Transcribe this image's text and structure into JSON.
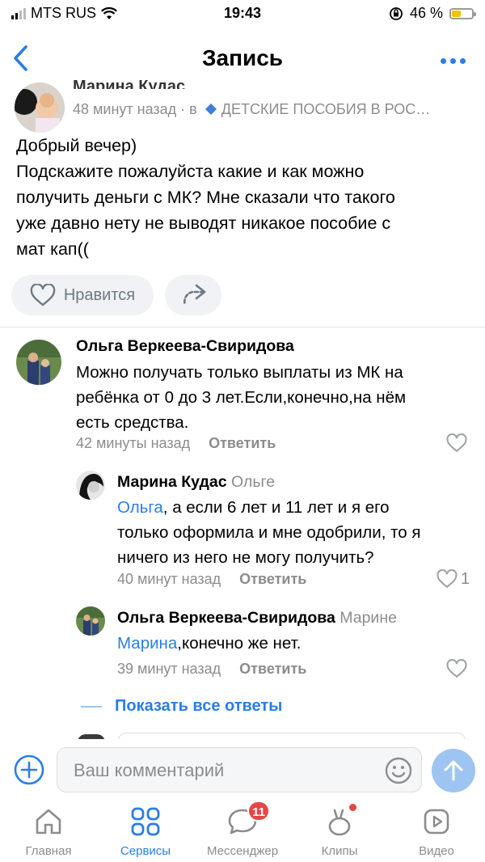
{
  "status_bar": {
    "carrier": "MTS RUS",
    "time": "19:43",
    "battery_text": "46 %",
    "battery_level": 0.46
  },
  "header": {
    "title": "Запись"
  },
  "post": {
    "author_partial": "Марина Кудас",
    "time": "48 минут назад",
    "in_sep": "· в",
    "group": "ДЕТСКИЕ ПОСОБИЯ В РОС…",
    "text_lines": [
      "Добрый вечер)",
      "Подскажите пожалуйста какие и как можно",
      "получить деньги с МК? Мне сказали что такого",
      "уже давно нету не выводят никакое пособие с",
      "мат кап(("
    ],
    "like_label": "Нравится"
  },
  "comments": [
    {
      "author": "Ольга Веркеева-Свиридова",
      "lines": [
        "Можно получать только выплаты из МК на",
        "ребёнка от 0 до 3 лет.Если,конечно,на нём",
        "есть средства."
      ],
      "time": "42 минуты назад",
      "reply_label": "Ответить"
    },
    {
      "author": "Марина Кудас",
      "to": "Ольге",
      "mention": "Ольга",
      "lines": [
        ", а если 6 лет и 11 лет и я его",
        "только оформила и мне одобрили, то я",
        "ничего из него не могу получить?"
      ],
      "time": "40 минут назад",
      "reply_label": "Ответить",
      "likes": "1"
    },
    {
      "author": "Ольга Веркеева-Свиридова",
      "to": "Марине",
      "mention": "Марина",
      "lines": [
        ",конечно же нет."
      ],
      "time": "39 минут назад",
      "reply_label": "Ответить"
    }
  ],
  "show_all_label": "Показать все ответы",
  "composer": {
    "placeholder": "Ваш комментарий"
  },
  "tabbar": {
    "tabs": [
      {
        "label": "Главная",
        "icon": "home-icon"
      },
      {
        "label": "Сервисы",
        "icon": "services-icon",
        "active": true
      },
      {
        "label": "Мессенджер",
        "icon": "messenger-icon",
        "badge": "11"
      },
      {
        "label": "Клипы",
        "icon": "clips-icon"
      },
      {
        "label": "Видео",
        "icon": "video-icon"
      }
    ]
  },
  "colors": {
    "accent": "#2a7ee5",
    "muted": "#8c8c8c",
    "badge": "#e64646"
  }
}
